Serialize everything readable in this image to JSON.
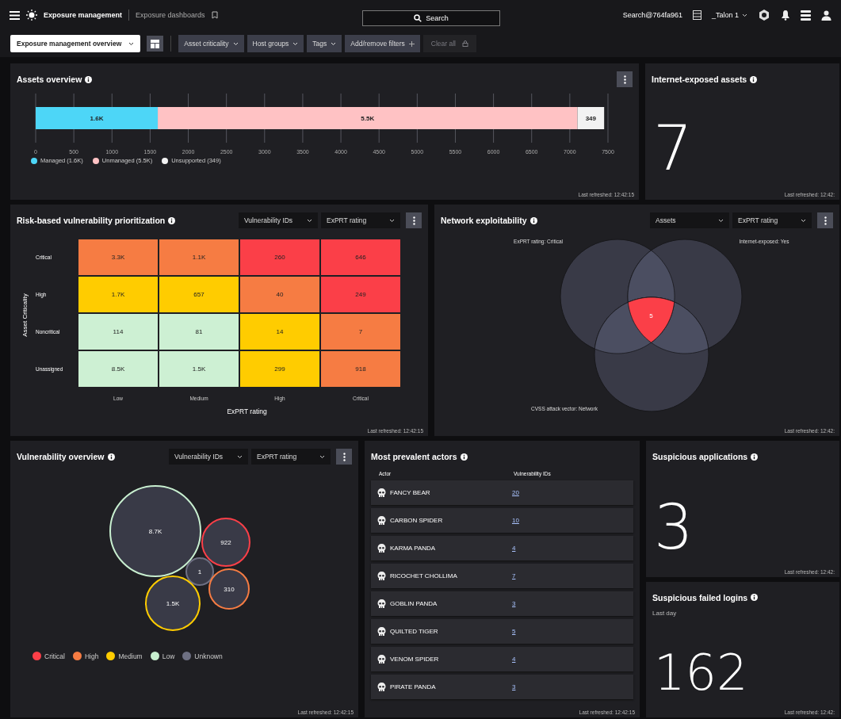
{
  "topbar": {
    "app_title": "Exposure management",
    "breadcrumb": "Exposure dashboards",
    "search": "Search",
    "account": "Search@764fa961",
    "tenant": "_Talon 1"
  },
  "filter_bar": {
    "dashboard_select": "Exposure management overview",
    "filters": [
      {
        "label": "Asset criticality",
        "kind": "dropdown"
      },
      {
        "label": "Host groups",
        "kind": "dropdown"
      },
      {
        "label": "Tags",
        "kind": "dropdown"
      },
      {
        "label": "Add/remove filters",
        "kind": "add"
      }
    ],
    "clear_all": {
      "label": "Clear all",
      "disabled": true
    }
  },
  "assets_overview": {
    "title": "Assets overview",
    "chart_data": {
      "type": "bar",
      "orientation": "horizontal",
      "stacked": true,
      "grid": true,
      "legend": "bottom",
      "series": [
        {
          "name": "Managed (1.6K)",
          "color": "#4dd6f7",
          "values": [
            1600
          ]
        },
        {
          "name": "Unmanaged (5.5K)",
          "color": "#ffc2c4",
          "values": [
            5500
          ]
        },
        {
          "name": "Unsupported (349)",
          "color": "#f2f2f2",
          "values": [
            350
          ]
        }
      ],
      "value_labels": [
        "1.6K",
        "5.5K",
        "349"
      ],
      "xlim": [
        0,
        7500
      ],
      "xticks": [
        0,
        500,
        1000,
        1500,
        2000,
        2500,
        3000,
        3500,
        4000,
        4500,
        5000,
        5500,
        6000,
        6500,
        7000,
        7500
      ]
    },
    "last_refreshed": "Last refreshed: 12:42:15"
  },
  "internet_exposed": {
    "title": "Internet-exposed assets",
    "value": "7",
    "last_refreshed": "Last refreshed: 12:42:"
  },
  "risk_prioritization": {
    "title": "Risk-based vulnerability prioritization",
    "selects": [
      "Vulnerability IDs",
      "ExPRT rating"
    ],
    "heatmap": {
      "ylabel": "Asset Criticality",
      "xlabel": "ExPRT rating",
      "rows": [
        {
          "label": "Critical",
          "cells": [
            {
              "value": "3.3K",
              "color": "#f67c43"
            },
            {
              "value": "1.1K",
              "color": "#f67c43"
            },
            {
              "value": "260",
              "color": "#fb3f48"
            },
            {
              "value": "646",
              "color": "#fb3f48"
            }
          ]
        },
        {
          "label": "High",
          "cells": [
            {
              "value": "1.7K",
              "color": "#ffcc00"
            },
            {
              "value": "657",
              "color": "#ffcc00"
            },
            {
              "value": "40",
              "color": "#f67c43"
            },
            {
              "value": "249",
              "color": "#fb3f48"
            }
          ]
        },
        {
          "label": "Noncritical",
          "cells": [
            {
              "value": "114",
              "color": "#cdf0d3"
            },
            {
              "value": "81",
              "color": "#cdf0d3"
            },
            {
              "value": "14",
              "color": "#ffcc00"
            },
            {
              "value": "7",
              "color": "#f67c43"
            }
          ]
        },
        {
          "label": "Unassigned",
          "cells": [
            {
              "value": "8.5K",
              "color": "#cdf0d3"
            },
            {
              "value": "1.5K",
              "color": "#cdf0d3"
            },
            {
              "value": "299",
              "color": "#ffcc00"
            },
            {
              "value": "918",
              "color": "#f67c43"
            }
          ]
        }
      ],
      "x_axis_labels": [
        "Low",
        "Medium",
        "High",
        "Critical"
      ]
    },
    "last_refreshed": "Last refreshed: 12:42:15"
  },
  "network_exploitability": {
    "title": "Network exploitability",
    "selects": [
      "Assets",
      "ExPRT rating"
    ],
    "sets": [
      "ExPRT rating: Critical",
      "Internet-exposed: Yes",
      "CVSS attack vector: Network"
    ],
    "intersection": "5",
    "last_refreshed": "Last refreshed: 12:42:"
  },
  "vulnerability_overview": {
    "title": "Vulnerability overview",
    "selects": [
      "Vulnerability IDs",
      "ExPRT rating"
    ],
    "bubbles": [
      {
        "label": "8.7K",
        "color": "#c8efd0"
      },
      {
        "label": "922",
        "color": "#fb3f48"
      },
      {
        "label": "1",
        "color": "#6e7083"
      },
      {
        "label": "310",
        "color": "#f67c43"
      },
      {
        "label": "1.5K",
        "color": "#ffcc00"
      }
    ],
    "legend": [
      {
        "label": "Critical",
        "color": "#fb3f48"
      },
      {
        "label": "High",
        "color": "#f67c43"
      },
      {
        "label": "Medium",
        "color": "#ffcc00"
      },
      {
        "label": "Low",
        "color": "#c8efd0"
      },
      {
        "label": "Unknown",
        "color": "#6e7083"
      }
    ],
    "last_refreshed": "Last refreshed: 12:42:15"
  },
  "prevalent_actors": {
    "title": "Most prevalent actors",
    "columns": [
      "Actor",
      "Vulnerability IDs"
    ],
    "rows": [
      {
        "actor": "FANCY BEAR",
        "count": "20"
      },
      {
        "actor": "CARBON SPIDER",
        "count": "10"
      },
      {
        "actor": "KARMA PANDA",
        "count": "4"
      },
      {
        "actor": "RICOCHET CHOLLIMA",
        "count": "7"
      },
      {
        "actor": "GOBLIN PANDA",
        "count": "3"
      },
      {
        "actor": "QUILTED TIGER",
        "count": "5"
      },
      {
        "actor": "VENOM SPIDER",
        "count": "4"
      },
      {
        "actor": "PIRATE PANDA",
        "count": "3"
      }
    ],
    "last_refreshed": "Last refreshed: 12:42:15"
  },
  "suspicious_applications": {
    "title": "Suspicious applications",
    "value": "3",
    "last_refreshed": "Last refreshed: 12:42:"
  },
  "suspicious_failed_logins": {
    "title": "Suspicious failed logins",
    "subtitle": "Last day",
    "value": "162",
    "last_refreshed": "Last refreshed: 12:42:"
  }
}
